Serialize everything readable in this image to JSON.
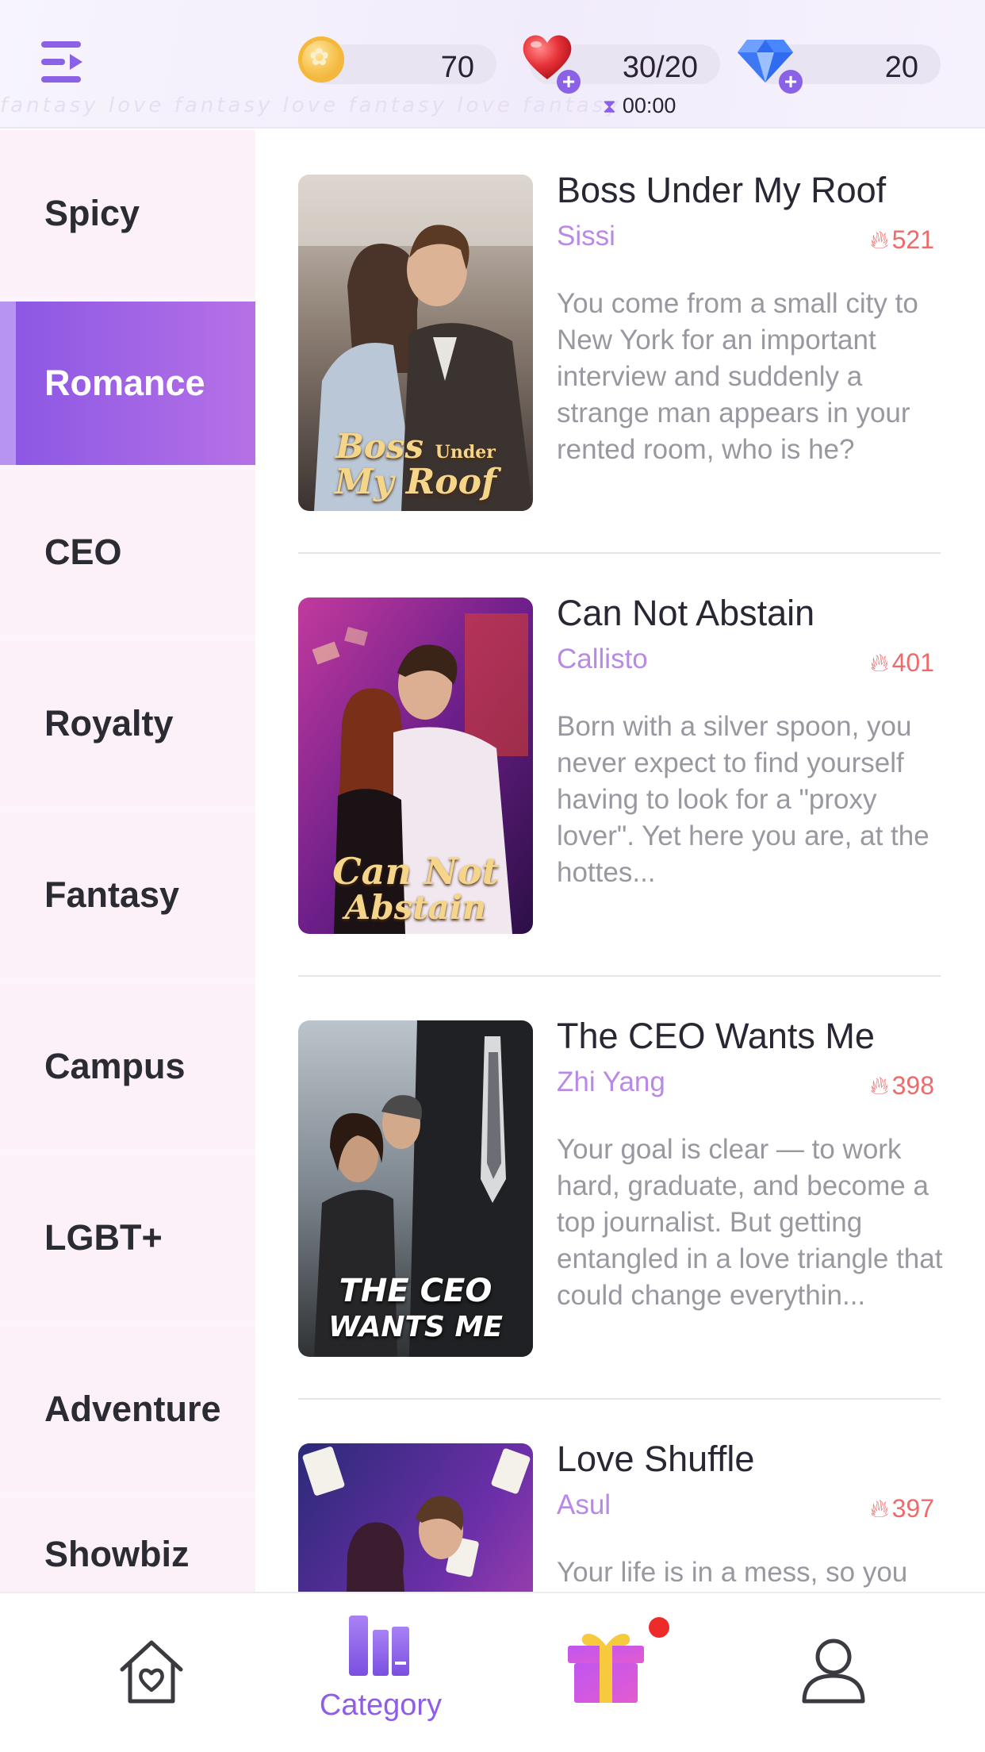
{
  "header": {
    "decor_text": "fantasy love fantasy love fantasy love fantasy",
    "coins": "70",
    "hearts": "30/20",
    "gems": "20",
    "timer": "00:00",
    "icons": {
      "menu": "menu-icon",
      "coin": "coin-icon",
      "heart": "heart-icon",
      "gem": "diamond-icon",
      "plus": "plus-icon",
      "hourglass": "hourglass-icon"
    },
    "colors": {
      "accent": "#8b62e6",
      "heart": "#e8333a",
      "gem": "#3a72f0"
    }
  },
  "sidebar": {
    "active_index": 1,
    "items": [
      {
        "label": "Spicy"
      },
      {
        "label": "Romance"
      },
      {
        "label": "CEO"
      },
      {
        "label": "Royalty"
      },
      {
        "label": "Fantasy"
      },
      {
        "label": "Campus"
      },
      {
        "label": "LGBT+"
      },
      {
        "label": "Adventure"
      },
      {
        "label": "Showbiz"
      }
    ]
  },
  "books": [
    {
      "title": "Boss Under My Roof",
      "author": "Sissi",
      "heat": "521",
      "description": "You come from a small city to New York for an important interview and suddenly a strange man appears in your rented room, who is he?",
      "cover_text_1": "Boss",
      "cover_text_small": "Under",
      "cover_text_2": "My Roof"
    },
    {
      "title": "Can Not Abstain",
      "author": "Callisto",
      "heat": "401",
      "description": "Born with a silver spoon, you never expect to find yourself having to look for a \"proxy lover\". Yet here you are, at the hottes...",
      "cover_text_1": "Can Not",
      "cover_text_2": "Abstain"
    },
    {
      "title": "The CEO Wants Me",
      "author": "Zhi Yang",
      "heat": "398",
      "description": "Your goal is clear — to work hard, graduate, and become a top journalist. But getting entangled in a love triangle that could change everythin...",
      "cover_text_1": "THE CEO",
      "cover_text_2": "WANTS ME"
    },
    {
      "title": "Love Shuffle",
      "author": "Asul",
      "heat": "397",
      "description": "Your life is in a mess, so you"
    }
  ],
  "bottom_nav": {
    "home_icon": "home-heart-icon",
    "category_icon": "books-icon",
    "category_label": "Category",
    "gift_icon": "gift-icon",
    "profile_icon": "user-icon",
    "active": "Category"
  }
}
